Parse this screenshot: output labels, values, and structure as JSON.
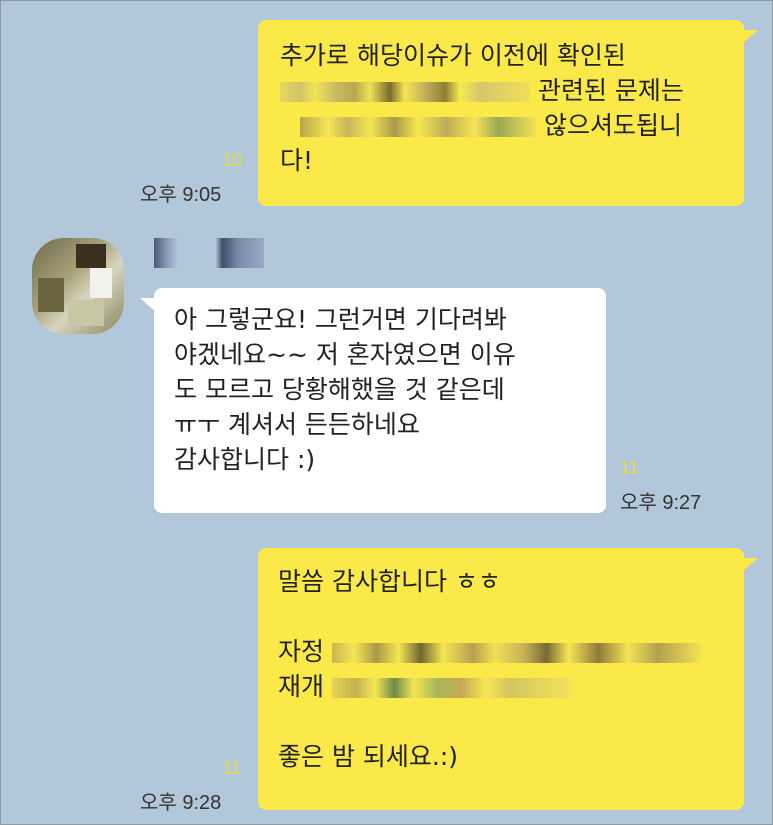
{
  "messages": [
    {
      "sender": "me",
      "lines": [
        "추가로 해당이슈가 이전에 확인된",
        "관련된 문제는",
        "않으셔도됩니",
        "다!"
      ],
      "unread": "10",
      "time": "오후 9:05"
    },
    {
      "sender": "them",
      "lines": [
        "아 그렇군요! 그런거면 기다려봐",
        "야겠네요~~ 저 혼자였으면 이유",
        "도 모르고 당황해했을 것 같은데",
        "ㅠㅜ 계셔서 든든하네요",
        "감사합니다 :)"
      ],
      "unread": "11",
      "time": "오후 9:27"
    },
    {
      "sender": "me",
      "lines": [
        "말씀 감사합니다 ㅎㅎ",
        "",
        "자정",
        "재개",
        "",
        "좋은 밤 되세요.:)"
      ],
      "unread": "11",
      "time": "오후 9:28"
    }
  ]
}
